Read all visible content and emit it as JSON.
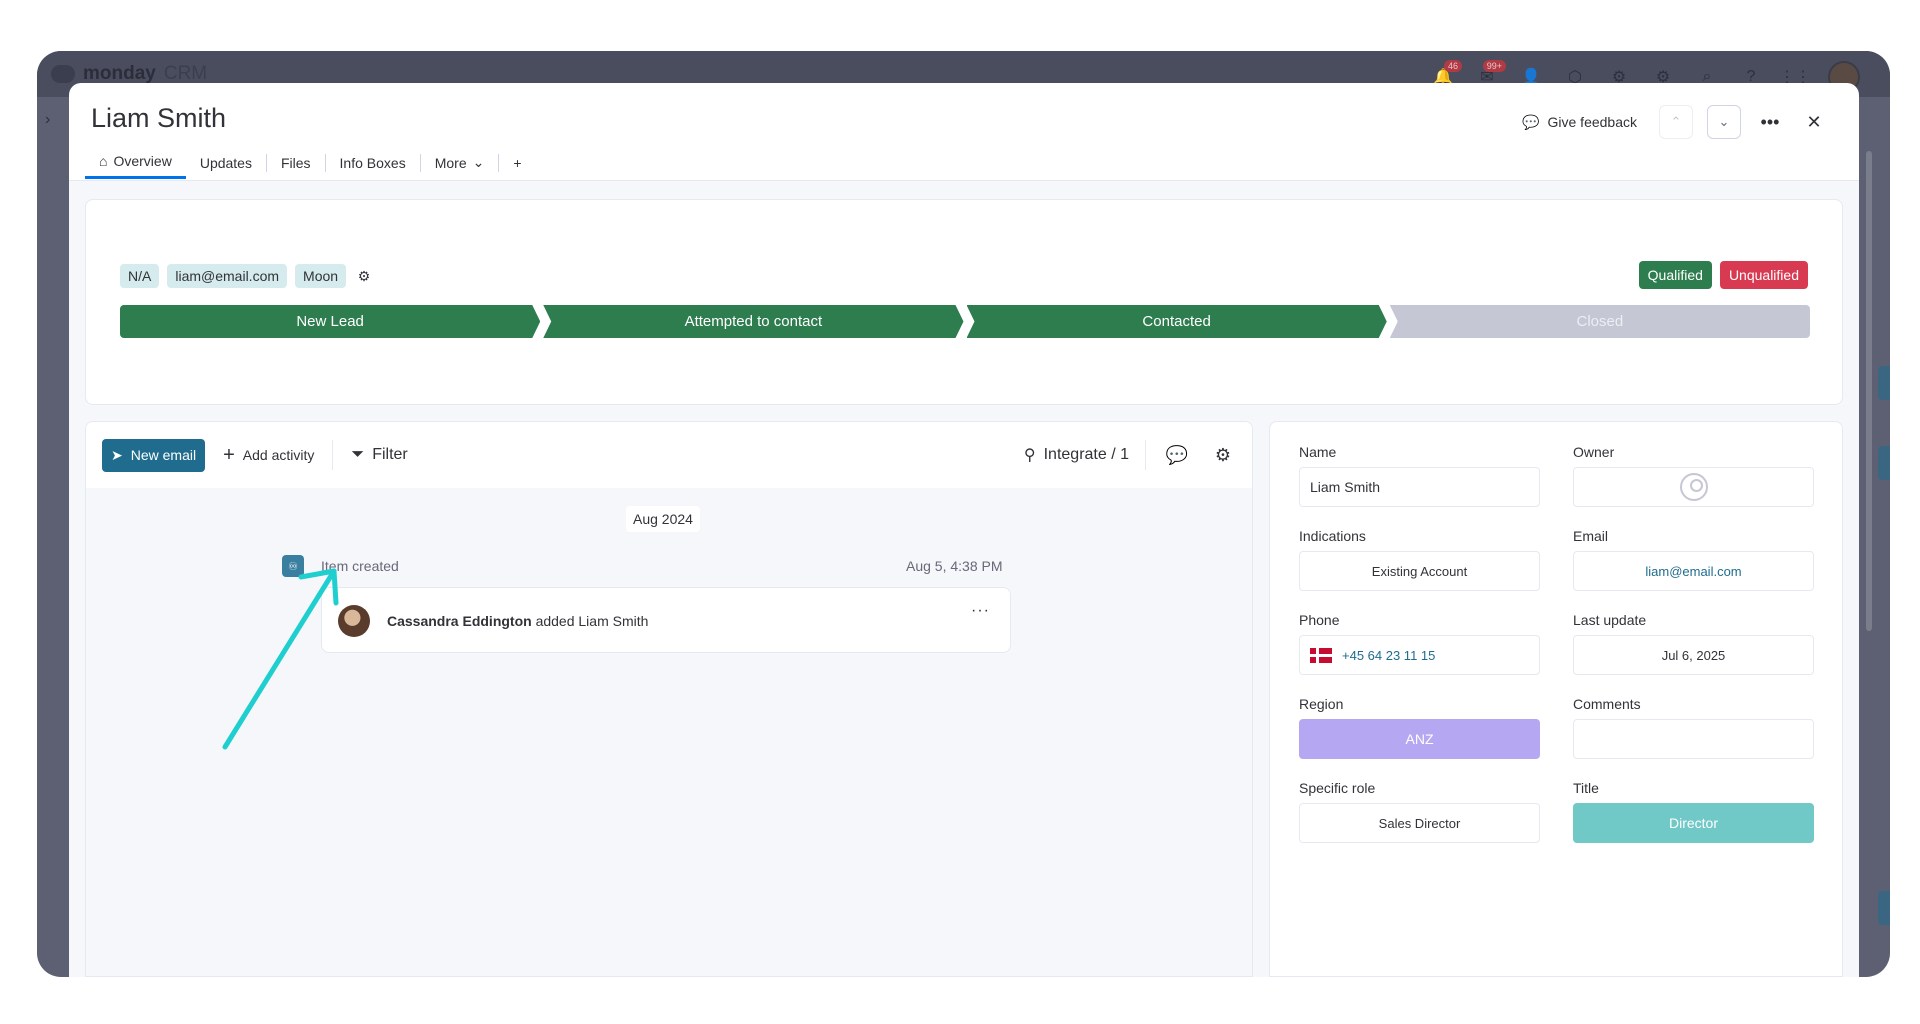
{
  "app": {
    "brand": "monday",
    "brand_suffix": "CRM",
    "notifications_count": "46",
    "inbox_count": "99+"
  },
  "modal": {
    "title": "Liam Smith",
    "feedback_label": "Give feedback",
    "tabs": [
      {
        "label": "Overview",
        "active": true,
        "icon": "home-icon"
      },
      {
        "label": "Updates"
      },
      {
        "label": "Files"
      },
      {
        "label": "Info Boxes"
      },
      {
        "label": "More",
        "icon": "chevron-down-icon"
      },
      {
        "label": "+"
      }
    ]
  },
  "stage_card": {
    "chips": [
      "N/A",
      "liam@email.com",
      "Moon"
    ],
    "qualified_label": "Qualified",
    "unqualified_label": "Unqualified",
    "stages": [
      {
        "label": "New Lead",
        "status": "done"
      },
      {
        "label": "Attempted to contact",
        "status": "done"
      },
      {
        "label": "Contacted",
        "status": "done"
      },
      {
        "label": "Closed",
        "status": "todo"
      }
    ],
    "colors": {
      "done": "#2e7d4f",
      "todo": "#c5c7d4",
      "qualified": "#2e7d4f",
      "unqualified": "#d83a52"
    }
  },
  "activity": {
    "new_email_label": "New email",
    "add_activity_label": "Add activity",
    "filter_label": "Filter",
    "integrate_label": "Integrate / 1",
    "date_group": "Aug 2024",
    "event": {
      "label": "Item created",
      "time": "Aug 5, 4:38 PM",
      "actor": "Cassandra Eddington",
      "action": "added Liam Smith",
      "more": "···"
    }
  },
  "fields": {
    "name": {
      "label": "Name",
      "value": "Liam Smith"
    },
    "owner": {
      "label": "Owner",
      "value": ""
    },
    "indications": {
      "label": "Indications",
      "value": "Existing Account"
    },
    "email": {
      "label": "Email",
      "value": "liam@email.com"
    },
    "phone": {
      "label": "Phone",
      "value": "+45 64 23 11 15",
      "flag": "denmark-flag-icon"
    },
    "last_update": {
      "label": "Last update",
      "value": "Jul 6, 2025"
    },
    "region": {
      "label": "Region",
      "value": "ANZ",
      "color": "#b6a7f2"
    },
    "comments": {
      "label": "Comments",
      "value": ""
    },
    "specific_role": {
      "label": "Specific role",
      "value": "Sales Director"
    },
    "title": {
      "label": "Title",
      "value": "Director",
      "color": "#71c9c7"
    }
  }
}
